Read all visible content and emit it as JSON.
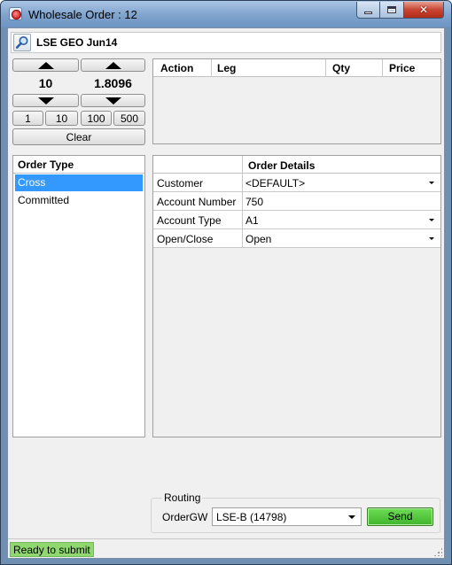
{
  "window": {
    "title": "Wholesale Order : 12",
    "close_glyph": "✕"
  },
  "instrument": {
    "label": "LSE GEO Jun14",
    "icon": "magnifier-icon"
  },
  "quantity": {
    "value": "10"
  },
  "price": {
    "value": "1.8096"
  },
  "presets": [
    "1",
    "10",
    "100",
    "500"
  ],
  "clear_label": "Clear",
  "legs_table": {
    "columns": [
      "Action",
      "Leg",
      "Qty",
      "Price"
    ],
    "rows": []
  },
  "order_type": {
    "header": "Order Type",
    "items": [
      "Cross",
      "Committed"
    ],
    "selected": "Cross"
  },
  "order_details": {
    "header": "Order Details",
    "rows": [
      {
        "label": "Customer",
        "value": "<DEFAULT>",
        "dropdown": true
      },
      {
        "label": "Account Number",
        "value": "750",
        "dropdown": false
      },
      {
        "label": "Account Type",
        "value": "A1",
        "dropdown": true
      },
      {
        "label": "Open/Close",
        "value": "Open",
        "dropdown": true
      }
    ]
  },
  "routing": {
    "legend": "Routing",
    "gateway_label": "OrderGW",
    "gateway_value": "LSE-B (14798)",
    "send_label": "Send"
  },
  "status": {
    "text": "Ready to submit"
  },
  "colors": {
    "selection": "#3399ff",
    "send_button": "#4cc73a",
    "status_ok": "#8fd86f"
  }
}
